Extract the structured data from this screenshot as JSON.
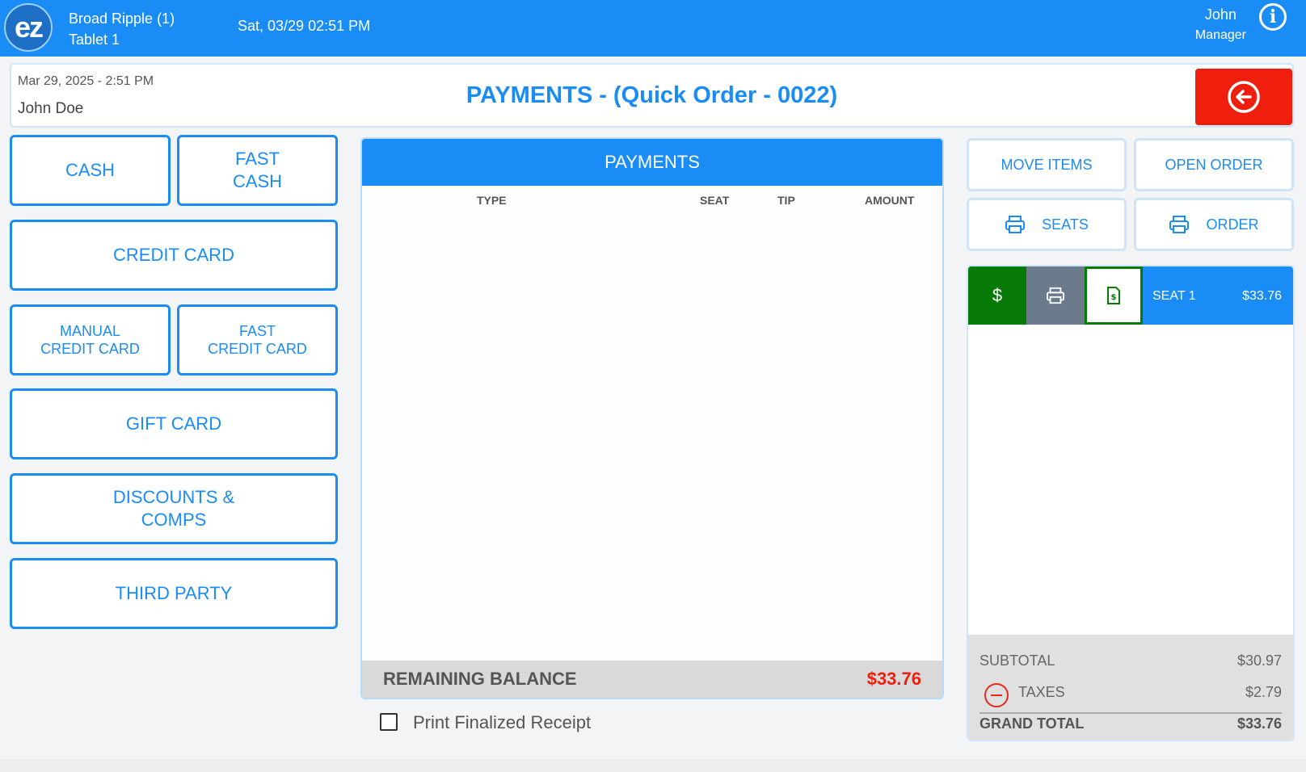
{
  "topbar": {
    "location": "Broad Ripple (1)",
    "device": "Tablet 1",
    "datetime": "Sat, 03/29 02:51 PM",
    "user_name": "John",
    "user_role": "Manager",
    "logo_text": "ez",
    "info_icon": "info-icon"
  },
  "header": {
    "date": "Mar 29, 2025  - 2:51 PM",
    "customer": "John Doe",
    "title": "PAYMENTS - (Quick Order - 0022)",
    "back_icon": "arrow-left-circle-icon"
  },
  "payment_buttons": {
    "cash": "CASH",
    "fast_cash": [
      "FAST",
      "CASH"
    ],
    "credit_card": "CREDIT CARD",
    "manual_credit_card": [
      "MANUAL",
      "CREDIT CARD"
    ],
    "fast_credit_card": [
      "FAST",
      "CREDIT CARD"
    ],
    "gift_card": "GIFT CARD",
    "discounts": [
      "DISCOUNTS &",
      "COMPS"
    ],
    "third_party": "THIRD PARTY"
  },
  "payments_panel": {
    "title": "PAYMENTS",
    "columns": [
      "TYPE",
      "SEAT",
      "TIP",
      "AMOUNT"
    ],
    "rows": [],
    "remaining_label": "REMAINING BALANCE",
    "remaining_value": "$33.76"
  },
  "print_receipt": {
    "label": "Print Finalized Receipt",
    "checked": false
  },
  "actions": {
    "move_items": "MOVE ITEMS",
    "open_order": "OPEN ORDER",
    "print_seats": "SEATS",
    "print_order": "ORDER"
  },
  "seat": {
    "label": "SEAT 1",
    "amount": "$33.76",
    "dollar_symbol": "$"
  },
  "totals": {
    "subtotal_label": "SUBTOTAL",
    "subtotal_value": "$30.97",
    "taxes_label": "TAXES",
    "taxes_value": "$2.79",
    "grand_total_label": "GRAND TOTAL",
    "grand_total_value": "$33.76"
  },
  "colors": {
    "primary": "#1a8cf6",
    "danger": "#f01e0c",
    "seat_pay": "#077a07",
    "seat_print": "#6b7b8c"
  }
}
